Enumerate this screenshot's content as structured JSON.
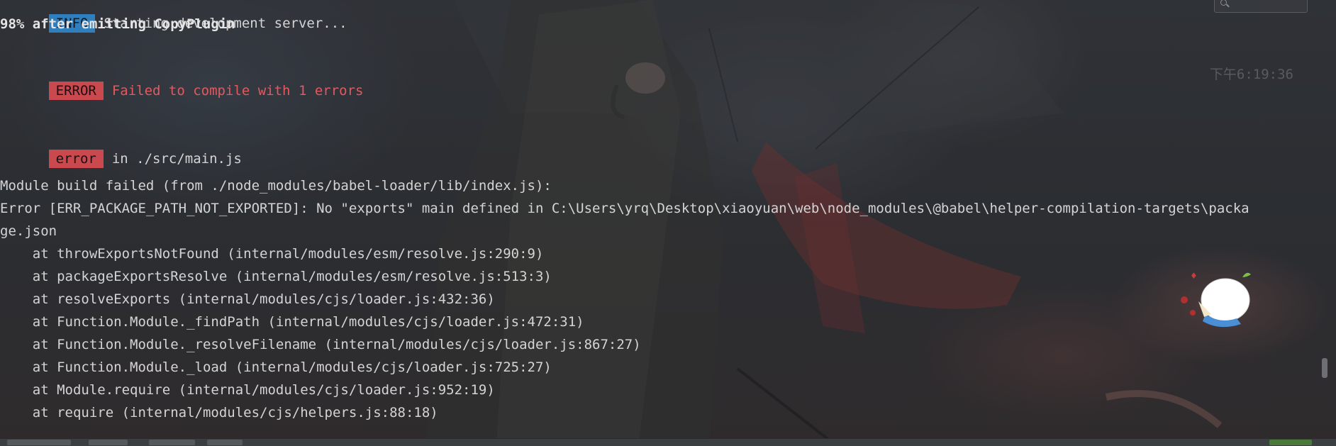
{
  "console": {
    "lines": [
      {
        "badge": "INFO",
        "text": "Starting development server..."
      },
      {
        "text": "98% after emitting CopyPlugin"
      },
      {
        "badge": "ERROR",
        "text": "Failed to compile with 1 errors"
      },
      {
        "badge": "error",
        "text": "in ./src/main.js"
      },
      {
        "text": "Module build failed (from ./node_modules/babel-loader/lib/index.js):"
      },
      {
        "text": "Error [ERR_PACKAGE_PATH_NOT_EXPORTED]: No \"exports\" main defined in C:\\Users\\yrq\\Desktop\\xiaoyuan\\web\\node_modules\\@babel\\helper-compilation-targets\\packa"
      },
      {
        "text": "ge.json"
      },
      {
        "text": "    at throwExportsNotFound (internal/modules/esm/resolve.js:290:9)"
      },
      {
        "text": "    at packageExportsResolve (internal/modules/esm/resolve.js:513:3)"
      },
      {
        "text": "    at resolveExports (internal/modules/cjs/loader.js:432:36)"
      },
      {
        "text": "    at Function.Module._findPath (internal/modules/cjs/loader.js:472:31)"
      },
      {
        "text": "    at Function.Module._resolveFilename (internal/modules/cjs/loader.js:867:27)"
      },
      {
        "text": "    at Function.Module._load (internal/modules/cjs/loader.js:725:27)"
      },
      {
        "text": "    at Module.require (internal/modules/cjs/loader.js:952:19)"
      },
      {
        "text": "    at require (internal/modules/cjs/helpers.js:88:18)"
      }
    ],
    "timestamp": "下午6:19:36"
  },
  "colors": {
    "info_badge": "#2f7fbf",
    "error_badge": "#c9494f",
    "error_text": "#e05a60",
    "text": "#d4d4d4"
  },
  "icons": {
    "search": "search-icon",
    "mascot": "mascot-sticker-icon"
  }
}
